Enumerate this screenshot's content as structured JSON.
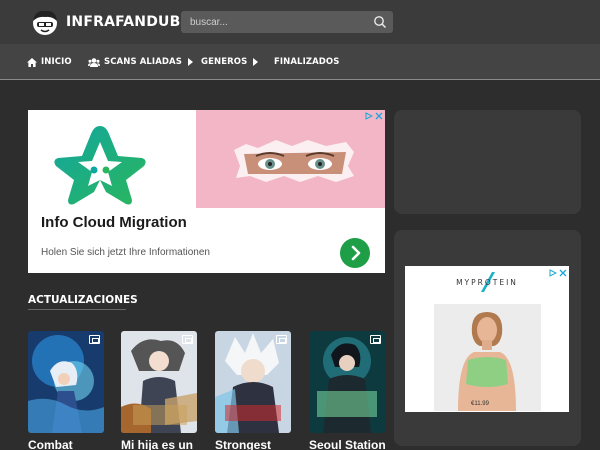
{
  "header": {
    "logo_text": "INFRAFANDUB",
    "search_placeholder": "buscar..."
  },
  "nav": {
    "items": [
      {
        "label": "INICIO",
        "icon": "home-icon"
      },
      {
        "label": "SCANS ALIADAS",
        "icon": "users-icon",
        "has_submenu": true
      },
      {
        "label": "GENEROS",
        "has_submenu": true
      },
      {
        "label": "FINALIZADOS"
      }
    ]
  },
  "ad_banner": {
    "title": "Info Cloud Migration",
    "subtitle": "Holen Sie sich jetzt Ihre Informationen",
    "accent": "#1e9e47"
  },
  "sidebar_ad": {
    "brand": "MYPROTEIN",
    "price": "€11.99"
  },
  "updates": {
    "title": "ACTUALIZACIONES",
    "items": [
      {
        "title": "Combat"
      },
      {
        "title": "Mi hija es un"
      },
      {
        "title": "Strongest"
      },
      {
        "title": "Seoul Station"
      }
    ]
  },
  "colors": {
    "header_bg": "#3b3b3b",
    "nav_bg": "#444444",
    "page_bg": "#2d2d2d",
    "panel_bg": "#3a3a3a"
  }
}
